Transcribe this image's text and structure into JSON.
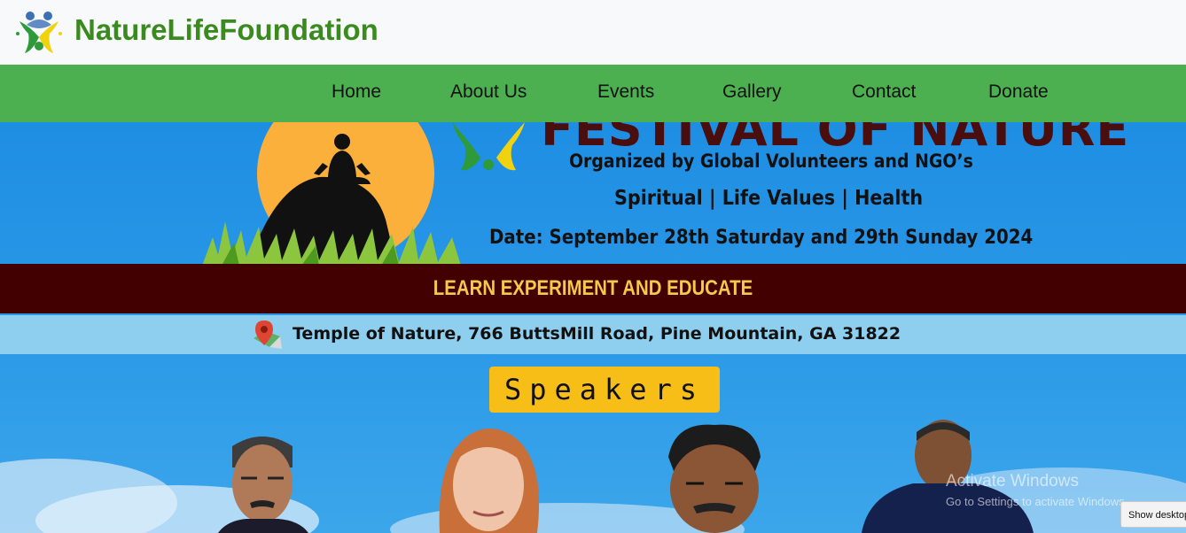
{
  "header": {
    "brand": "NatureLifeFoundation"
  },
  "nav": {
    "items": [
      {
        "label": "Home"
      },
      {
        "label": "About Us"
      },
      {
        "label": "Events"
      },
      {
        "label": "Gallery"
      },
      {
        "label": "Contact"
      },
      {
        "label": "Donate"
      }
    ]
  },
  "banner": {
    "title": "FESTIVAL OF NATURE",
    "organized_by": "Organized by Global Volunteers and NGO’s",
    "themes": "Spiritual  | Life Values | Health",
    "date": "Date: September 28th Saturday and 29th Sunday 2024",
    "tagline": "LEARN EXPERIMENT AND EDUCATE",
    "address": "Temple of Nature, 766 ButtsMill Road, Pine Mountain, GA 31822",
    "speakers_heading": "Speakers"
  },
  "os_overlay": {
    "activate_title": "Activate Windows",
    "activate_subtitle": "Go to Settings to activate Windows.",
    "show_desktop": "Show desktop"
  },
  "colors": {
    "brand_green": "#3a8b1e",
    "nav_green": "#4caf50",
    "band_dark": "#420001",
    "band_text": "#f6c94a",
    "speakers_box": "#f7be18",
    "sky": "#1f8ee0"
  }
}
